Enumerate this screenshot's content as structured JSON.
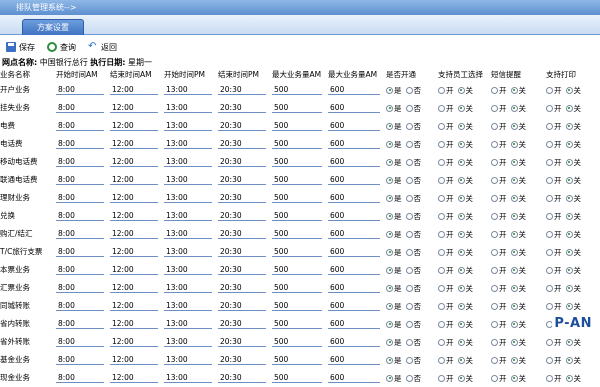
{
  "title": "排队管理系统-->",
  "tab": "方案设置",
  "toolbar": {
    "save": "保存",
    "query": "查询",
    "back": "返回"
  },
  "info": {
    "branch_label": "网点名称:",
    "branch_value": "中国银行总行",
    "date_label": "执行日期:",
    "date_value": "星期一"
  },
  "headers": [
    "业务名称",
    "开始时间AM",
    "结束时间AM",
    "开始时间PM",
    "结束时间PM",
    "最大业务量AM",
    "最大业务量AM",
    "是否开通",
    "支持员工选择",
    "短信提醒",
    "支持打印"
  ],
  "labels": {
    "yes": "是",
    "no": "否",
    "on": "开",
    "off": "关"
  },
  "rows": [
    {
      "name": "开户业务",
      "am_start": "8:00",
      "am_end": "12:00",
      "pm_start": "13:00",
      "pm_end": "20:30",
      "max_am": "500",
      "max_pm": "600"
    },
    {
      "name": "挂失业务",
      "am_start": "8:00",
      "am_end": "12:00",
      "pm_start": "13:00",
      "pm_end": "20:30",
      "max_am": "500",
      "max_pm": "600"
    },
    {
      "name": "电费",
      "am_start": "8:00",
      "am_end": "12:00",
      "pm_start": "13:00",
      "pm_end": "20:30",
      "max_am": "500",
      "max_pm": "600"
    },
    {
      "name": "电话费",
      "am_start": "8:00",
      "am_end": "12:00",
      "pm_start": "13:00",
      "pm_end": "20:30",
      "max_am": "500",
      "max_pm": "600"
    },
    {
      "name": "移动电话费",
      "am_start": "8:00",
      "am_end": "12:00",
      "pm_start": "13:00",
      "pm_end": "20:30",
      "max_am": "500",
      "max_pm": "600"
    },
    {
      "name": "联通电话费",
      "am_start": "8:00",
      "am_end": "12:00",
      "pm_start": "13:00",
      "pm_end": "20:30",
      "max_am": "500",
      "max_pm": "600"
    },
    {
      "name": "理财业务",
      "am_start": "8:00",
      "am_end": "12:00",
      "pm_start": "13:00",
      "pm_end": "20:30",
      "max_am": "500",
      "max_pm": "600"
    },
    {
      "name": "兑换",
      "am_start": "8:00",
      "am_end": "12:00",
      "pm_start": "13:00",
      "pm_end": "20:30",
      "max_am": "500",
      "max_pm": "600"
    },
    {
      "name": "购汇/结汇",
      "am_start": "8:00",
      "am_end": "12:00",
      "pm_start": "13:00",
      "pm_end": "20:30",
      "max_am": "500",
      "max_pm": "600"
    },
    {
      "name": "T/C旅行支票",
      "am_start": "8:00",
      "am_end": "12:00",
      "pm_start": "13:00",
      "pm_end": "20:30",
      "max_am": "500",
      "max_pm": "600"
    },
    {
      "name": "本票业务",
      "am_start": "8:00",
      "am_end": "12:00",
      "pm_start": "13:00",
      "pm_end": "20:30",
      "max_am": "500",
      "max_pm": "600"
    },
    {
      "name": "汇票业务",
      "am_start": "8:00",
      "am_end": "12:00",
      "pm_start": "13:00",
      "pm_end": "20:30",
      "max_am": "500",
      "max_pm": "600"
    },
    {
      "name": "同城转账",
      "am_start": "8:00",
      "am_end": "12:00",
      "pm_start": "13:00",
      "pm_end": "20:30",
      "max_am": "500",
      "max_pm": "600"
    },
    {
      "name": "省内转账",
      "am_start": "8:00",
      "am_end": "12:00",
      "pm_start": "13:00",
      "pm_end": "20:30",
      "max_am": "500",
      "max_pm": "600"
    },
    {
      "name": "省外转账",
      "am_start": "8:00",
      "am_end": "12:00",
      "pm_start": "13:00",
      "pm_end": "20:30",
      "max_am": "500",
      "max_pm": "600"
    },
    {
      "name": "基金业务",
      "am_start": "8:00",
      "am_end": "12:00",
      "pm_start": "13:00",
      "pm_end": "20:30",
      "max_am": "500",
      "max_pm": "600"
    },
    {
      "name": "现金业务",
      "am_start": "8:00",
      "am_end": "12:00",
      "pm_start": "13:00",
      "pm_end": "20:30",
      "max_am": "500",
      "max_pm": "600"
    }
  ],
  "logo": "P-AN"
}
